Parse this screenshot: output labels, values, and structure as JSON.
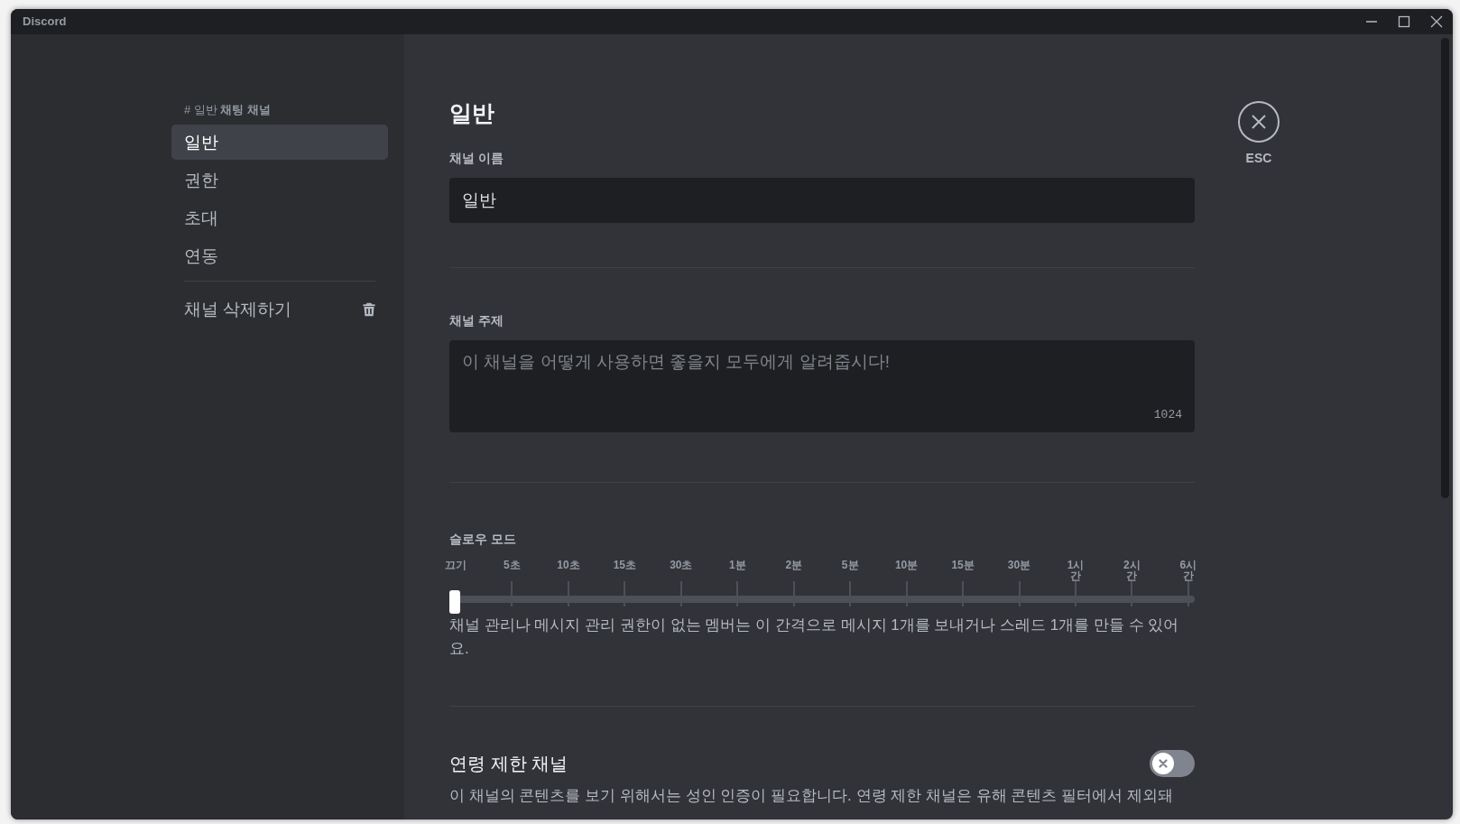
{
  "window": {
    "title": "Discord"
  },
  "sidebar": {
    "header": "# 일반 **채팅 채널**",
    "items": [
      {
        "label": "일반",
        "selected": true
      },
      {
        "label": "권한",
        "selected": false
      },
      {
        "label": "초대",
        "selected": false
      },
      {
        "label": "연동",
        "selected": false
      }
    ],
    "delete_label": "채널 삭제하기"
  },
  "close": {
    "label": "ESC"
  },
  "page": {
    "title": "일반"
  },
  "name_field": {
    "label": "채널 이름",
    "value": "일반"
  },
  "topic_field": {
    "label": "채널 주제",
    "placeholder": "이 채널을 어떻게 사용하면 좋을지 모두에게 알려줍시다!",
    "counter": "1024"
  },
  "slow_mode": {
    "label": "슬로우 모드",
    "ticks": [
      "끄기",
      "5초",
      "10초",
      "15초",
      "30초",
      "1분",
      "2분",
      "5분",
      "10분",
      "15분",
      "30분",
      "1시간",
      "2시간",
      "6시간"
    ],
    "level": 0,
    "description": "채널 관리나 메시지 관리 권한이 없는 멤버는 이 간격으로 메시지 1개를 보내거나 스레드 1개를 만들 수 있어요."
  },
  "age_restricted": {
    "label": "연령 제한 채널",
    "on": false,
    "description": "이 채널의 콘텐츠를 보기 위해서는 성인 인증이 필요합니다. 연령 제한 채널은 유해 콘텐츠 필터에서 제외돼"
  }
}
